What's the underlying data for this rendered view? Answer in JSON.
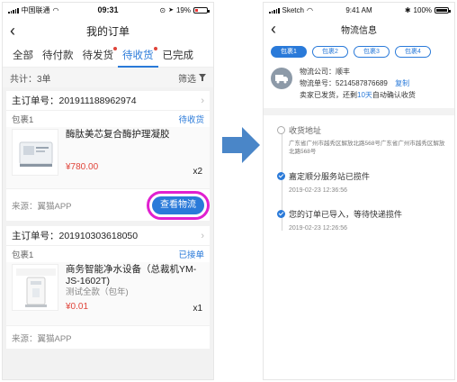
{
  "left": {
    "status": {
      "carrier": "中国联通",
      "time": "09:31",
      "battery": "19%",
      "battery_level": 0.19
    },
    "title": "我的订单",
    "tabs": [
      {
        "label": "全部",
        "active": false,
        "dot": false
      },
      {
        "label": "待付款",
        "active": false,
        "dot": false
      },
      {
        "label": "待发货",
        "active": false,
        "dot": true
      },
      {
        "label": "待收货",
        "active": true,
        "dot": true
      },
      {
        "label": "已完成",
        "active": false,
        "dot": false
      }
    ],
    "summary": {
      "total": "共计：3单",
      "filter": "筛选"
    },
    "orders": [
      {
        "order_no": "主订单号：201911188962974",
        "package": "包裹1",
        "status": "待收货",
        "product": "酶肽美芯复合酶护理凝胶",
        "spec": "",
        "price": "¥780.00",
        "qty": "x2",
        "source": "来源：翼猫APP",
        "action": "查看物流"
      },
      {
        "order_no": "主订单号：201910303618050",
        "package": "包裹1",
        "status": "已接单",
        "product": "商务智能净水设备（总裁机YM-JS-1602T)",
        "spec": "测试全款（包年)",
        "price": "¥0.01",
        "qty": "x1",
        "source": "来源：翼猫APP"
      }
    ]
  },
  "right": {
    "status": {
      "carrier": "Sketch",
      "time": "9:41 AM",
      "battery": "100%"
    },
    "title": "物流信息",
    "package_tabs": [
      {
        "label": "包裹1",
        "active": true
      },
      {
        "label": "包裹2",
        "active": false
      },
      {
        "label": "包裹3",
        "active": false
      },
      {
        "label": "包裹4",
        "active": false
      }
    ],
    "carrier": {
      "company": "物流公司：顺丰",
      "tracking_no": "物流单号：5214587876689",
      "copy": "复制",
      "notice_prefix": "卖家已发货，还剩",
      "notice_days": "10天",
      "notice_suffix": "自动确认收货"
    },
    "timeline": [
      {
        "title": "收货地址",
        "detail": "广东省广州市越秀区解放北路568号广东省广州市越秀区解放北路568号",
        "time": "",
        "done": false
      },
      {
        "title": "嘉定顺分服务站已揽件",
        "detail": "",
        "time": "2019-02-23   12:36:56",
        "done": true
      },
      {
        "title": "您的订单已导入，等待快递揽件",
        "detail": "",
        "time": "2019-02-23   12:26:56",
        "done": true
      }
    ]
  },
  "colors": {
    "accent": "#2a7ad9",
    "price": "#e0443a",
    "highlight": "#e020d0",
    "arrow": "#4a86c8"
  }
}
